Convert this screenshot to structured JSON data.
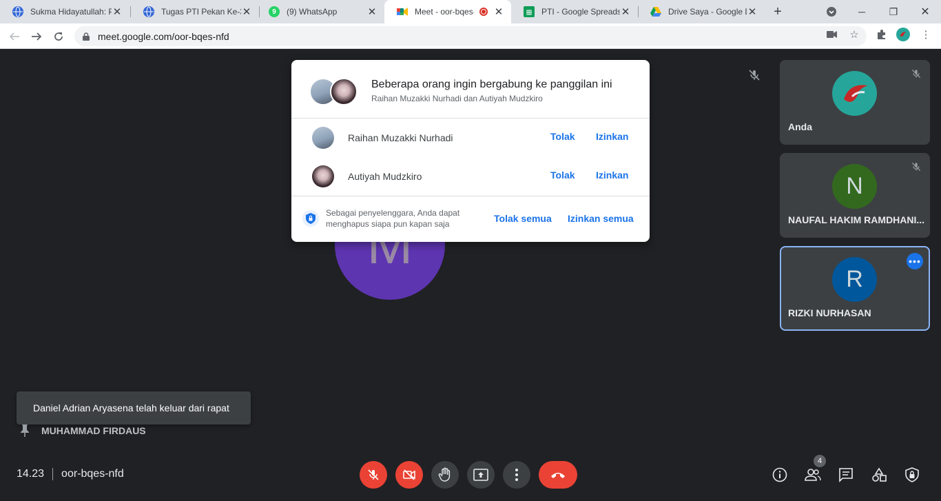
{
  "browser": {
    "tabs": [
      {
        "title": "Sukma Hidayatullah: P",
        "icon": "globe-icon",
        "color": "#3367d6"
      },
      {
        "title": "Tugas PTI Pekan Ke-3.",
        "icon": "globe-icon",
        "color": "#3367d6"
      },
      {
        "title": "(9) WhatsApp",
        "icon": "whatsapp-icon",
        "color": "#25d366"
      },
      {
        "title": "Meet - oor-bqes-",
        "icon": "meet-icon",
        "color": "#00897b"
      },
      {
        "title": "PTI - Google Spreadsh",
        "icon": "sheets-icon",
        "color": "#0f9d58"
      },
      {
        "title": "Drive Saya - Google D",
        "icon": "drive-icon",
        "color": "#fbbc04"
      }
    ],
    "tab_whatsapp_badge": "9",
    "url": "meet.google.com/oor-bqes-nfd"
  },
  "dialog": {
    "title": "Beberapa orang ingin bergabung ke panggilan ini",
    "subtitle": "Raihan Muzakki Nurhadi dan Autiyah Mudzkiro",
    "requests": [
      {
        "name": "Raihan Muzakki Nurhadi",
        "deny": "Tolak",
        "admit": "Izinkan"
      },
      {
        "name": "Autiyah Mudzkiro",
        "deny": "Tolak",
        "admit": "Izinkan"
      }
    ],
    "footer_text": "Sebagai penyelenggara, Anda dapat menghapus siapa pun kapan saja",
    "deny_all": "Tolak semua",
    "admit_all": "Izinkan semua"
  },
  "main": {
    "avatar_letter": "M",
    "presenter": "MUHAMMAD FIRDAUS",
    "toast": "Daniel Adrian Aryasena telah keluar dari rapat"
  },
  "tiles": [
    {
      "name": "Anda",
      "avatar_color": "#26a69a"
    },
    {
      "name": "NAUFAL HAKIM RAMDHANI...",
      "letter": "N",
      "avatar_color": "#33691e"
    },
    {
      "name": "RIZKI NURHASAN",
      "letter": "R",
      "avatar_color": "#01579b"
    }
  ],
  "bottom": {
    "time": "14.23",
    "meeting_code": "oor-bqes-nfd",
    "participants_count": "4"
  }
}
